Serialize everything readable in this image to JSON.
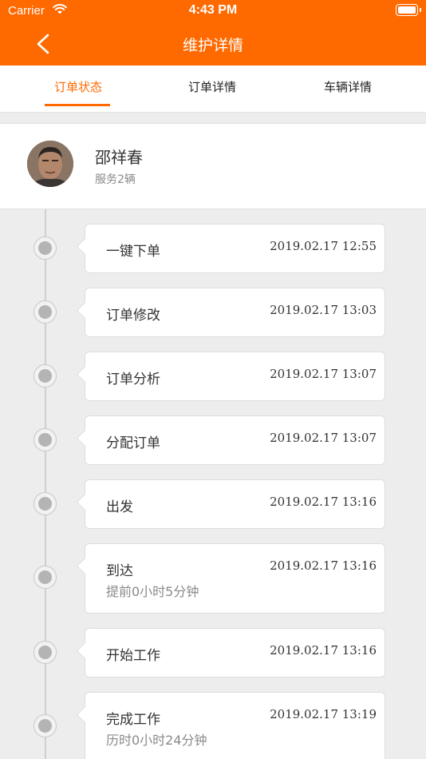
{
  "status_bar": {
    "carrier": "Carrier",
    "time": "4:43 PM"
  },
  "nav": {
    "title": "维护详情"
  },
  "tabs": [
    {
      "label": "订单状态",
      "active": true
    },
    {
      "label": "订单详情",
      "active": false
    },
    {
      "label": "车辆详情",
      "active": false
    }
  ],
  "profile": {
    "name": "邵祥春",
    "subtitle": "服务2辆"
  },
  "timeline": [
    {
      "title": "一键下单",
      "time": "2019.02.17 12:55",
      "note": ""
    },
    {
      "title": "订单修改",
      "time": "2019.02.17 13:03",
      "note": ""
    },
    {
      "title": "订单分析",
      "time": "2019.02.17 13:07",
      "note": ""
    },
    {
      "title": "分配订单",
      "time": "2019.02.17 13:07",
      "note": ""
    },
    {
      "title": "出发",
      "time": "2019.02.17 13:16",
      "note": ""
    },
    {
      "title": "到达",
      "time": "2019.02.17 13:16",
      "note": "提前0小时5分钟"
    },
    {
      "title": "开始工作",
      "time": "2019.02.17 13:16",
      "note": ""
    },
    {
      "title": "完成工作",
      "time": "2019.02.17 13:19",
      "note": "历时0小时24分钟"
    }
  ],
  "colors": {
    "accent": "#ff6a00",
    "background": "#ededed",
    "card": "#ffffff"
  },
  "icons": {
    "back": "chevron-left-icon",
    "wifi": "wifi-icon",
    "battery": "battery-icon"
  }
}
